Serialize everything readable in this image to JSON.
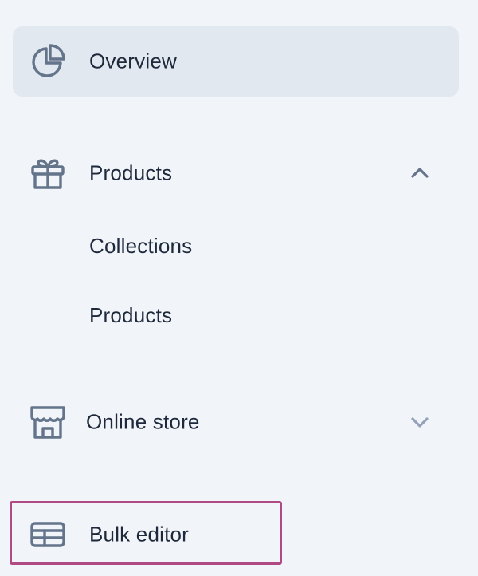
{
  "nav": {
    "overview": {
      "label": "Overview",
      "icon": "pie-chart-icon",
      "active": true
    },
    "products": {
      "label": "Products",
      "icon": "gift-icon",
      "expanded": true,
      "chevron": "chevron-up-icon",
      "children": [
        {
          "label": "Collections"
        },
        {
          "label": "Products"
        }
      ]
    },
    "online_store": {
      "label": "Online store",
      "icon": "storefront-icon",
      "expanded": false,
      "chevron": "chevron-down-icon"
    },
    "bulk_editor": {
      "label": "Bulk editor",
      "icon": "table-icon"
    }
  },
  "colors": {
    "background": "#f1f4f9",
    "active_background": "#e2e8f0",
    "text": "#1e293b",
    "icon": "#64748b",
    "chevron": "#94a3b8",
    "highlight": "#b04a85"
  }
}
